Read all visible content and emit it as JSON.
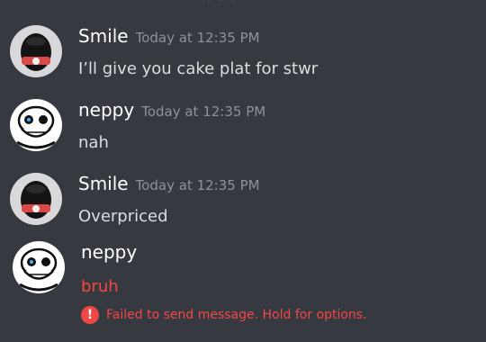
{
  "messages": [
    {
      "author": "Smile",
      "timestamp": "Today at 12:35 PM",
      "text": "I’ll give you cake plat for stwr",
      "avatar": "smile-avatar"
    },
    {
      "author": "neppy",
      "timestamp": "Today at 12:35 PM",
      "text": "nah",
      "avatar": "skull-avatar"
    },
    {
      "author": "Smile",
      "timestamp": "Today at 12:35 PM",
      "text": "Overpriced",
      "avatar": "smile-avatar"
    },
    {
      "author": "neppy",
      "timestamp": "",
      "text": "bruh",
      "avatar": "skull-avatar",
      "status": "failed"
    }
  ],
  "failure": {
    "icon": "!",
    "text": "Failed to send message. Hold for options."
  },
  "colors": {
    "background": "#36393f",
    "username": "#ffffff",
    "timestamp": "#8e9297",
    "message_text": "#dcddde",
    "error": "#f04747"
  }
}
